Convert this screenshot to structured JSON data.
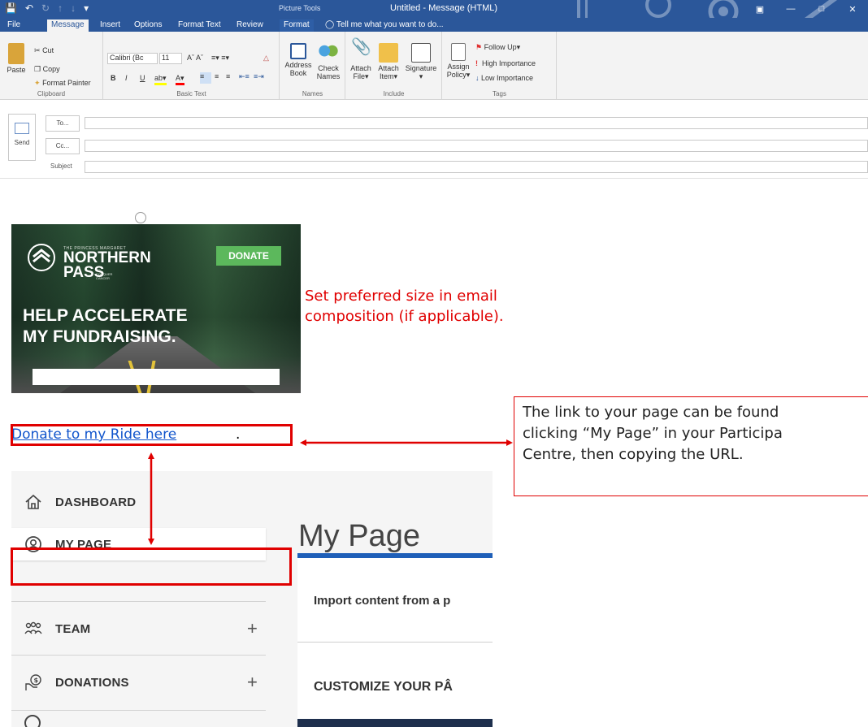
{
  "window": {
    "title": "Untitled - Message (HTML)",
    "context_title": "Picture Tools",
    "quick_access": [
      "save-icon",
      "undo-icon",
      "redo-icon",
      "up-icon",
      "down-icon",
      "customize-icon"
    ]
  },
  "tabs": [
    {
      "label": "File"
    },
    {
      "label": "Message"
    },
    {
      "label": "Insert"
    },
    {
      "label": "Options"
    },
    {
      "label": "Format Text"
    },
    {
      "label": "Review"
    },
    {
      "label": "Format"
    }
  ],
  "tell_me": "Tell me what you want to do...",
  "ribbon": {
    "clipboard": {
      "paste": "Paste",
      "cut": "Cut",
      "copy": "Copy",
      "format_painter": "Format Painter",
      "group": "Clipboard"
    },
    "basic_text": {
      "font": "Calibri (Bc",
      "size": "11",
      "bold": "B",
      "italic": "I",
      "underline": "U",
      "group": "Basic Text"
    },
    "names": {
      "address_book_1": "Address",
      "address_book_2": "Book",
      "check_names_1": "Check",
      "check_names_2": "Names",
      "group": "Names"
    },
    "include": {
      "attach_file_1": "Attach",
      "attach_file_2": "File",
      "attach_item_1": "Attach",
      "attach_item_2": "Item",
      "signature": "Signature",
      "group": "Include"
    },
    "tags": {
      "assign_policy_1": "Assign",
      "assign_policy_2": "Policy",
      "follow_up": "Follow Up",
      "high_importance": "High Importance",
      "low_importance": "Low Importance",
      "group": "Tags"
    }
  },
  "compose": {
    "send": "Send",
    "to": "To...",
    "cc": "Cc...",
    "subject": "Subject"
  },
  "banner": {
    "brand_small": "THE PRINCESS MARGARET",
    "brand_line1": "NORTHERN",
    "brand_line2": "PASS",
    "brand_tag": "TO CONQUER CANCER",
    "donate": "DONATE",
    "headline_line1": "HELP ACCELERATE",
    "headline_line2": "MY FUNDRAISING."
  },
  "annotation": {
    "size_note_line1": "Set preferred size in email",
    "size_note_line2": "composition (if applicable)."
  },
  "link": {
    "text": "Donate to my Ride here",
    "trailing": "."
  },
  "callout": {
    "line1": "The link to your page can be found",
    "line2": "clicking “My Page” in your Participa",
    "line3": "Centre, then copying the URL."
  },
  "participant_centre": {
    "nav": [
      {
        "label": "DASHBOARD",
        "icon": "home-icon"
      },
      {
        "label": "MY PAGE",
        "icon": "user-circle-icon"
      },
      {
        "label": "TEAM",
        "icon": "team-icon",
        "expand": "+"
      },
      {
        "label": "DONATIONS",
        "icon": "donation-icon",
        "expand": "+"
      }
    ],
    "page_title": "My Page",
    "card_row1": "Import content from a p",
    "card_row2": "CUSTOMIZE YOUR PÂ"
  },
  "colors": {
    "outlook_blue": "#2b579a",
    "annotation_red": "#e00000",
    "link_blue": "#1155cc",
    "donate_green": "#5cb85c"
  }
}
